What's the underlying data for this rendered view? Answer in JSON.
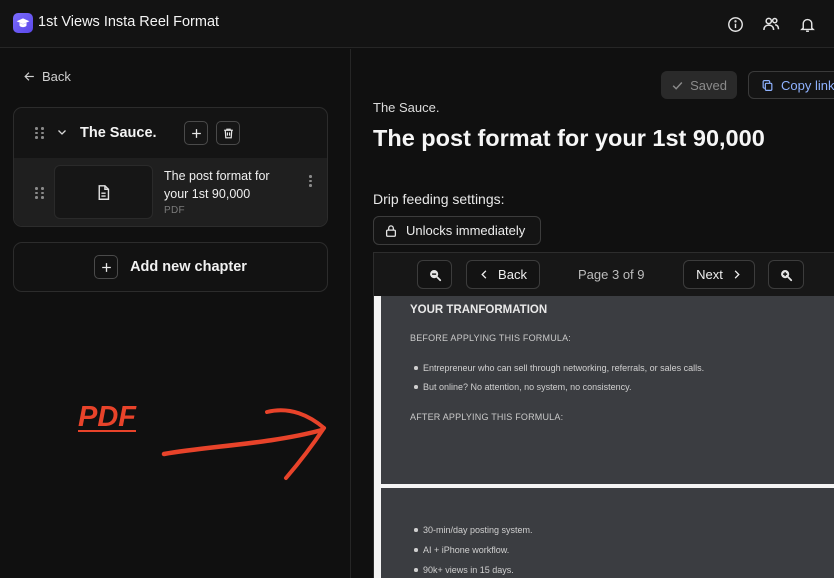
{
  "header": {
    "app_title": "1st Views Insta Reel Format",
    "icons": [
      "graduation-cap-icon",
      "info-icon",
      "users-icon",
      "bell-icon"
    ]
  },
  "sidebar": {
    "back_label": "Back",
    "chapter": {
      "title": "The Sauce.",
      "lessons": [
        {
          "title": "The post format for your 1st 90,000",
          "type": "PDF"
        }
      ]
    },
    "add_chapter_label": "Add new chapter",
    "annotation_label": "PDF"
  },
  "main": {
    "saved_label": "Saved",
    "copy_link_label": "Copy link",
    "breadcrumb": "The Sauce.",
    "title": "The post format for your 1st 90,000",
    "drip_label": "Drip feeding settings:",
    "unlock_label": "Unlocks immediately",
    "viewer": {
      "back_label": "Back",
      "page_info": "Page 3 of 9",
      "next_label": "Next",
      "page1": {
        "heading": "YOUR TRANFORMATION",
        "before_label": "BEFORE APPLYING THIS FORMULA:",
        "before_items": [
          "Entrepreneur who can sell through networking, referrals, or sales calls.",
          "But online? No attention, no system, no consistency."
        ],
        "after_label": "AFTER APPLYING THIS FORMULA:"
      },
      "page2": {
        "items": [
          "30-min/day posting system.",
          "AI + iPhone workflow.",
          "90k+ views in 15 days."
        ]
      }
    }
  },
  "colors": {
    "accent_link": "#8fb2ff",
    "annotation_red": "#e8432a",
    "logo_purple": "#6b5cf6"
  }
}
